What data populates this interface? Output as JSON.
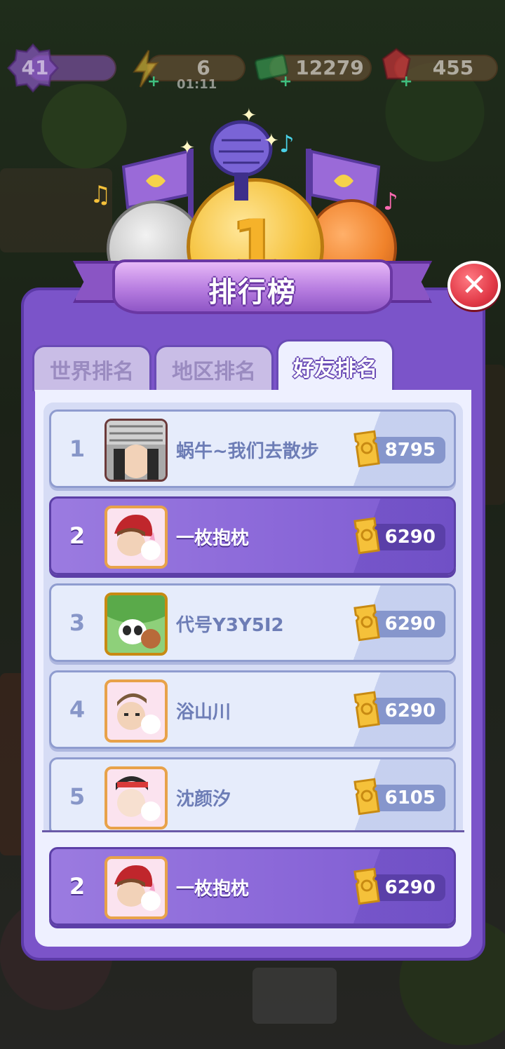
{
  "hud": {
    "level": "41",
    "energy": "6",
    "energy_timer": "01:11",
    "cash": "12279",
    "gems": "455"
  },
  "header": {
    "title": "排行榜",
    "center_medal": "1"
  },
  "tabs": [
    {
      "label": "世界排名",
      "active": false
    },
    {
      "label": "地区排名",
      "active": false
    },
    {
      "label": "好友排名",
      "active": true
    }
  ],
  "leaderboard": [
    {
      "rank": "1",
      "name": "蜗牛~我们去散步",
      "score": "8795",
      "me": false
    },
    {
      "rank": "2",
      "name": "一枚抱枕",
      "score": "6290",
      "me": true
    },
    {
      "rank": "3",
      "name": "代号Y3Y5I2",
      "score": "6290",
      "me": false
    },
    {
      "rank": "4",
      "name": "浴山川",
      "score": "6290",
      "me": false
    },
    {
      "rank": "5",
      "name": "沈颜汐",
      "score": "6105",
      "me": false
    }
  ],
  "my_entry": {
    "rank": "2",
    "name": "一枚抱枕",
    "score": "6290"
  },
  "colors": {
    "panel": "#7b54c9",
    "highlight_row": "#8a67d8",
    "close": "#e23a48",
    "gold": "#f5c13a",
    "silver": "#c9c9c9",
    "bronze": "#f0822a"
  }
}
